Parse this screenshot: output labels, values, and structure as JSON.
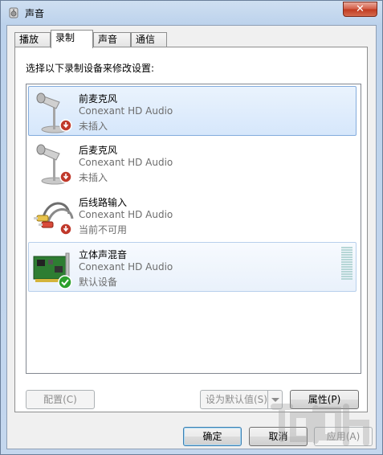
{
  "window": {
    "title": "声音",
    "close_glyph": "✕"
  },
  "tabs": [
    {
      "label": "播放"
    },
    {
      "label": "录制",
      "active": true
    },
    {
      "label": "声音"
    },
    {
      "label": "通信"
    }
  ],
  "instruction": "选择以下录制设备来修改设置:",
  "devices": [
    {
      "name": "前麦克风",
      "driver": "Conexant HD Audio",
      "status": "未插入",
      "icon": "microphone-icon",
      "badge": "unplugged-badge-icon",
      "state": "selected"
    },
    {
      "name": "后麦克风",
      "driver": "Conexant HD Audio",
      "status": "未插入",
      "icon": "microphone-icon",
      "badge": "unplugged-badge-icon",
      "state": "normal"
    },
    {
      "name": "后线路输入",
      "driver": "Conexant HD Audio",
      "status": "当前不可用",
      "icon": "rca-cable-icon",
      "badge": "unplugged-badge-icon",
      "state": "normal"
    },
    {
      "name": "立体声混音",
      "driver": "Conexant HD Audio",
      "status": "默认设备",
      "icon": "sound-card-icon",
      "badge": "default-check-icon",
      "state": "highlight"
    }
  ],
  "buttons": {
    "configure": "配置(C)",
    "set_default": "设为默认值(S)",
    "properties": "属性(P)",
    "ok": "确定",
    "cancel": "取消",
    "apply": "应用(A)"
  },
  "colors": {
    "selection": "#d6e7fb",
    "unplugged_badge": "#c0392b",
    "default_check": "#2ca02c",
    "level_meter": "#b6d6d6"
  }
}
